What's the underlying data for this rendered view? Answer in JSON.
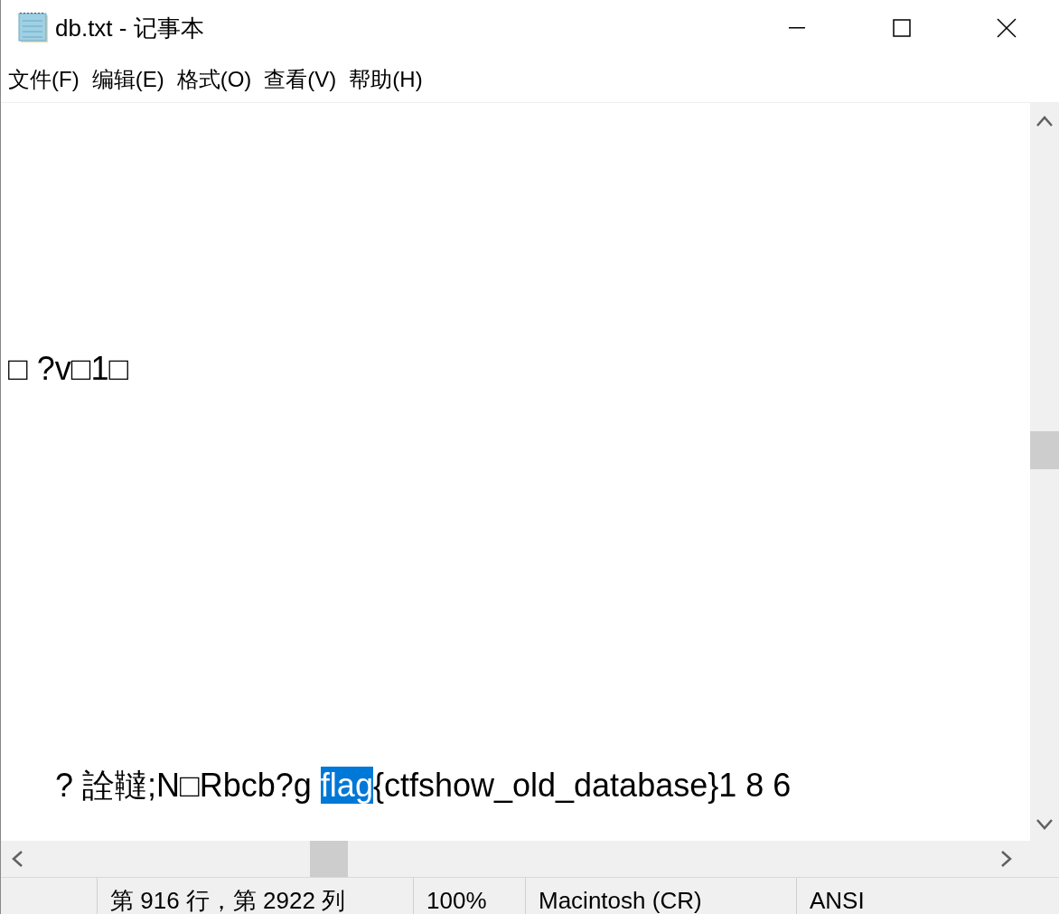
{
  "window": {
    "title": "db.txt - 记事本"
  },
  "menu": [
    "文件(F)",
    "编辑(E)",
    "格式(O)",
    "查看(V)",
    "帮助(H)"
  ],
  "editor": {
    "lines": [
      {
        "segments": [
          {
            "text": "□ ?v□1□",
            "selected": false
          }
        ]
      },
      {
        "segments": [
          {
            "text": "? 詮韃;N□Rbcb?g ",
            "selected": false
          },
          {
            "text": "flag",
            "selected": true
          },
          {
            "text": "{ctfshow_old_database}1 8 6",
            "selected": false
          }
        ]
      }
    ]
  },
  "status_bar": [
    "第 916 行，第 2922 列",
    "100%",
    "Macintosh (CR)",
    "ANSI"
  ]
}
